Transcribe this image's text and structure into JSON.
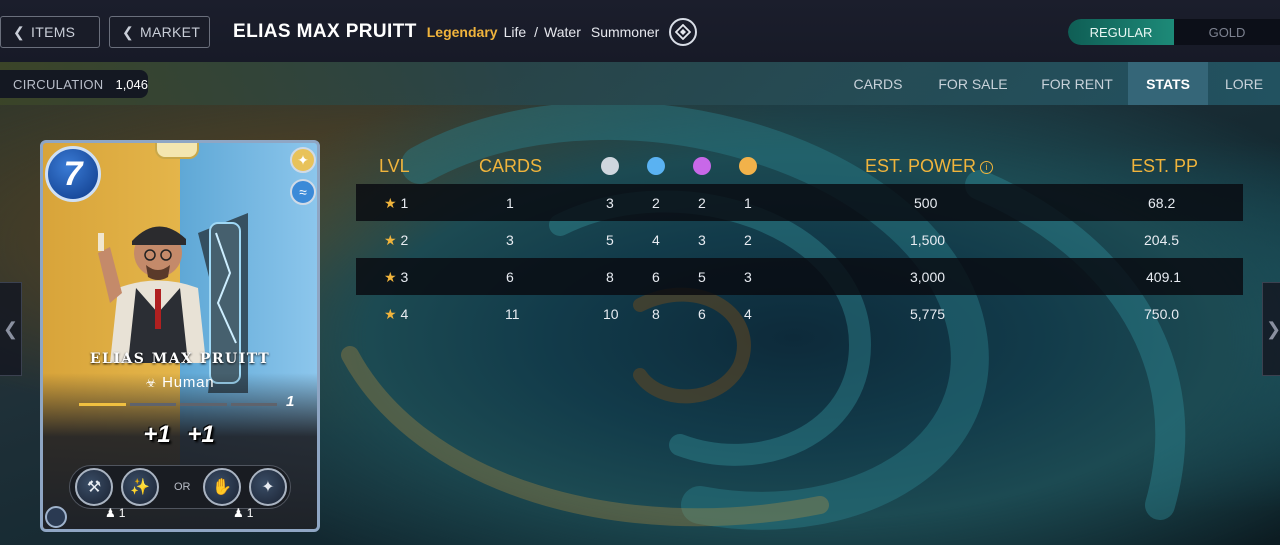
{
  "header": {
    "items_label": "ITEMS",
    "market_label": "MARKET",
    "title": "ELIAS MAX PRUITT",
    "rarity": "Legendary",
    "element_primary": "Life",
    "element_secondary": "Water",
    "card_type": "Summoner",
    "toggle": {
      "regular": "REGULAR",
      "gold": "GOLD",
      "selected": "REGULAR"
    }
  },
  "subbar": {
    "circulation_label": "CIRCULATION",
    "circulation_value": "1,046",
    "tabs": [
      {
        "label": "CARDS",
        "active": false
      },
      {
        "label": "FOR SALE",
        "active": false
      },
      {
        "label": "FOR RENT",
        "active": false
      },
      {
        "label": "STATS",
        "active": true
      },
      {
        "label": "LORE",
        "active": false
      }
    ]
  },
  "card": {
    "mana": "7",
    "name": "ELIAS MAX PRUITT",
    "race": "Human",
    "level": "1",
    "level_progress": 0.25,
    "buffs": [
      "+1",
      "+1"
    ],
    "or_label": "OR",
    "requirements": [
      "1",
      "1"
    ],
    "ability_icons": [
      "hammer-icon",
      "sparkle-icon",
      "fist-icon",
      "wand-icon"
    ]
  },
  "stats": {
    "headers": {
      "lvl": "LVL",
      "cards": "CARDS",
      "est_power": "EST. POWER",
      "est_pp": "EST. PP"
    },
    "foil_dot_colors": [
      "#cfd6de",
      "#5ab2f2",
      "#c868e8",
      "#f2b24a"
    ],
    "rows": [
      {
        "lvl": "1",
        "cards": "1",
        "d1": "3",
        "d2": "2",
        "d3": "2",
        "d4": "1",
        "power": "500",
        "pp": "68.2"
      },
      {
        "lvl": "2",
        "cards": "3",
        "d1": "5",
        "d2": "4",
        "d3": "3",
        "d4": "2",
        "power": "1,500",
        "pp": "204.5"
      },
      {
        "lvl": "3",
        "cards": "6",
        "d1": "8",
        "d2": "6",
        "d3": "5",
        "d4": "3",
        "power": "3,000",
        "pp": "409.1"
      },
      {
        "lvl": "4",
        "cards": "11",
        "d1": "10",
        "d2": "8",
        "d3": "6",
        "d4": "4",
        "power": "5,775",
        "pp": "750.0"
      }
    ]
  },
  "colors": {
    "accent_gold": "#f0b43c",
    "toggle_active": "#1d8a78",
    "header_bg": "#1b1e2c"
  }
}
